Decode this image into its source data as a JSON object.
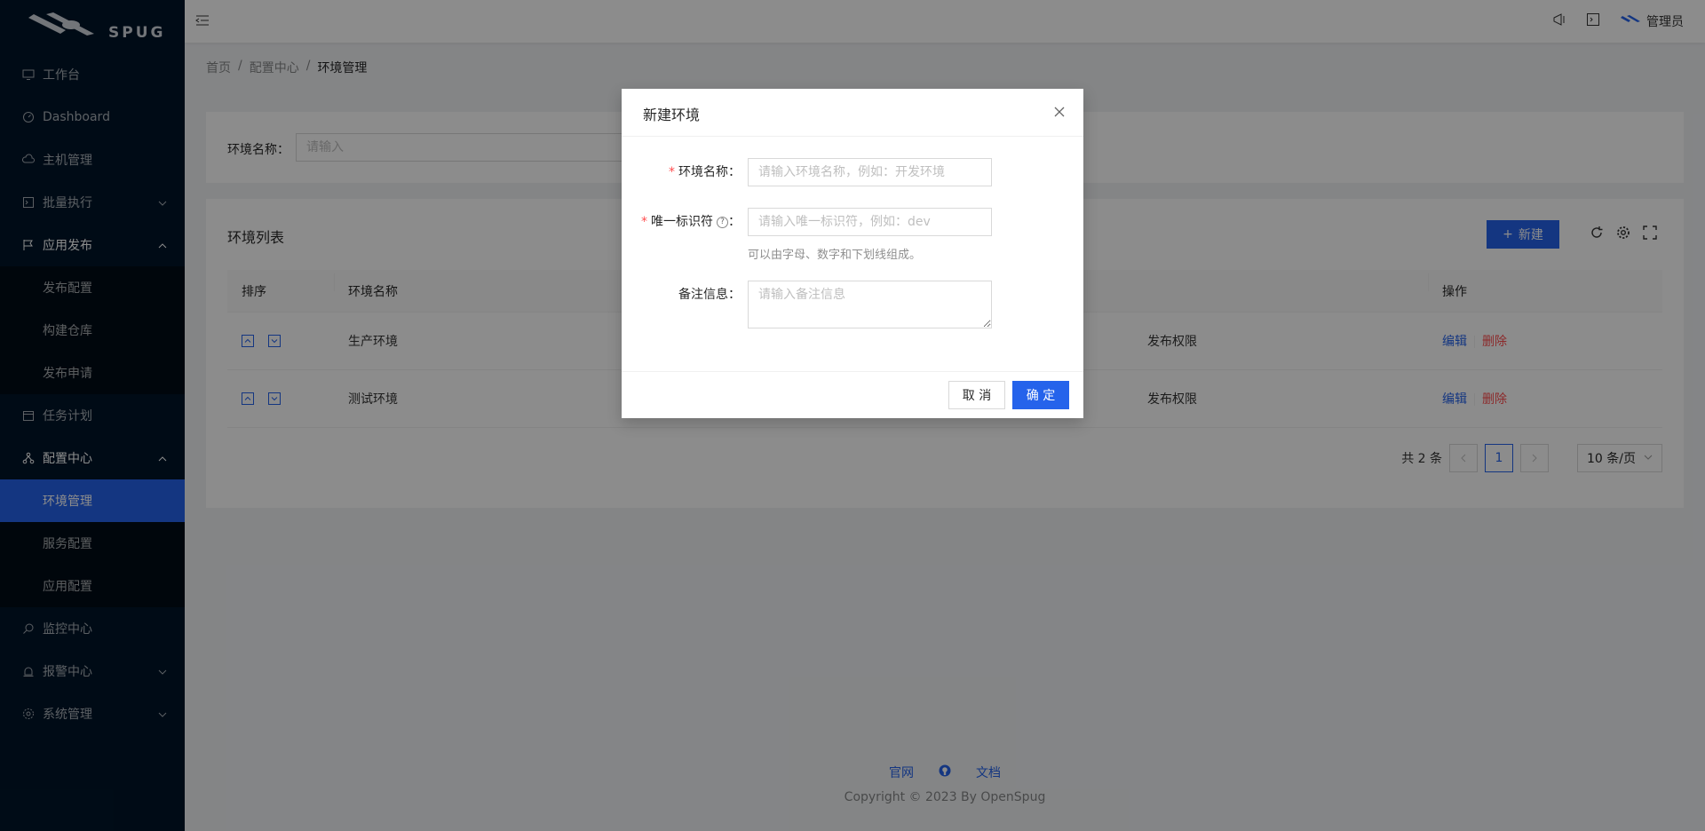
{
  "logo": {
    "text": "SPUG"
  },
  "sidebar": {
    "items": [
      {
        "label": "工作台",
        "icon": "desktop-icon"
      },
      {
        "label": "Dashboard",
        "icon": "dashboard-icon"
      },
      {
        "label": "主机管理",
        "icon": "cloud-icon"
      },
      {
        "label": "批量执行",
        "icon": "code-icon"
      },
      {
        "label": "应用发布",
        "icon": "flag-icon"
      },
      {
        "label": "任务计划",
        "icon": "schedule-icon"
      },
      {
        "label": "配置中心",
        "icon": "cluster-icon"
      },
      {
        "label": "监控中心",
        "icon": "monitor-icon"
      },
      {
        "label": "报警中心",
        "icon": "alert-icon"
      },
      {
        "label": "系统管理",
        "icon": "setting-icon"
      }
    ],
    "release_sub": [
      "发布配置",
      "构建仓库",
      "发布申请"
    ],
    "config_sub": [
      "环境管理",
      "服务配置",
      "应用配置"
    ]
  },
  "header": {
    "user": "管理员"
  },
  "breadcrumb": {
    "home": "首页",
    "parent": "配置中心",
    "current": "环境管理"
  },
  "search": {
    "label": "环境名称：",
    "placeholder": "请输入"
  },
  "table": {
    "title": "环境列表",
    "new_label": "新建",
    "columns": {
      "sort": "排序",
      "name": "环境名称",
      "op": "操作"
    },
    "rows": [
      {
        "name": "生产环境",
        "desc": "发布权限"
      },
      {
        "name": "测试环境",
        "desc": "发布权限"
      }
    ],
    "edit_label": "编辑",
    "delete_label": "删除"
  },
  "pagination": {
    "total": "共 2 条",
    "current": "1",
    "page_size": "10 条/页"
  },
  "footer": {
    "link1": "官网",
    "link2": "文档",
    "copyright": "Copyright © 2023 By OpenSpug"
  },
  "modal": {
    "title": "新建环境",
    "name_label": "环境名称",
    "name_placeholder": "请输入环境名称，例如：开发环境",
    "key_label": "唯一标识符",
    "key_placeholder": "请输入唯一标识符，例如：dev",
    "key_help": "可以由字母、数字和下划线组成。",
    "desc_label": "备注信息",
    "desc_placeholder": "请输入备注信息",
    "cancel_label": "取 消",
    "ok_label": "确 定"
  },
  "colors": {
    "primary": "#2563eb",
    "sidebar_bg": "#001529",
    "danger": "#ff4d4f"
  }
}
